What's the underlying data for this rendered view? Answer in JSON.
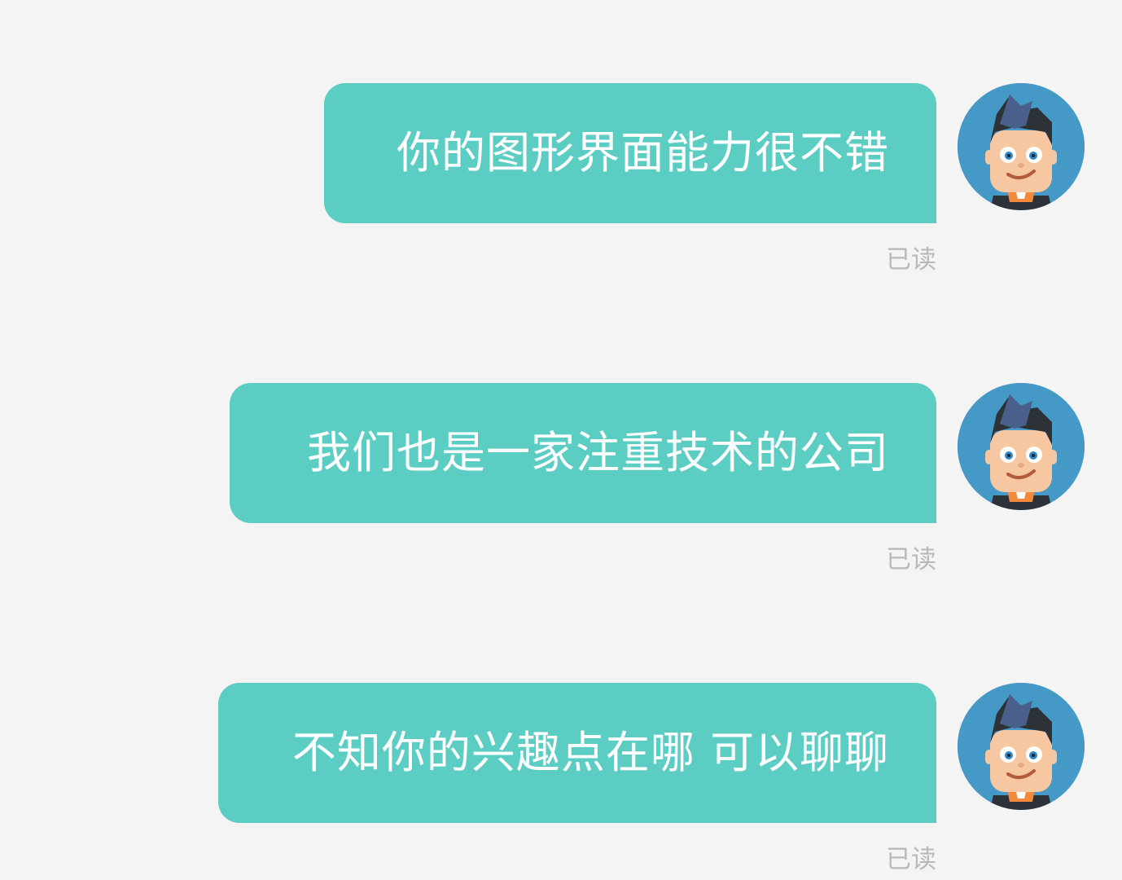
{
  "messages": [
    {
      "text": "你的图形界面能力很不错",
      "status": "已读"
    },
    {
      "text": "我们也是一家注重技术的公司",
      "status": "已读"
    },
    {
      "text": "不知你的兴趣点在哪 可以聊聊",
      "status": "已读"
    }
  ],
  "avatar_icon": "cartoon-man-icon",
  "colors": {
    "background": "#f4f4f5",
    "bubble": "#5ccdc3",
    "bubble_text": "#ffffff",
    "status_text": "#b9b9b9",
    "avatar_bg": "#4499c7"
  }
}
